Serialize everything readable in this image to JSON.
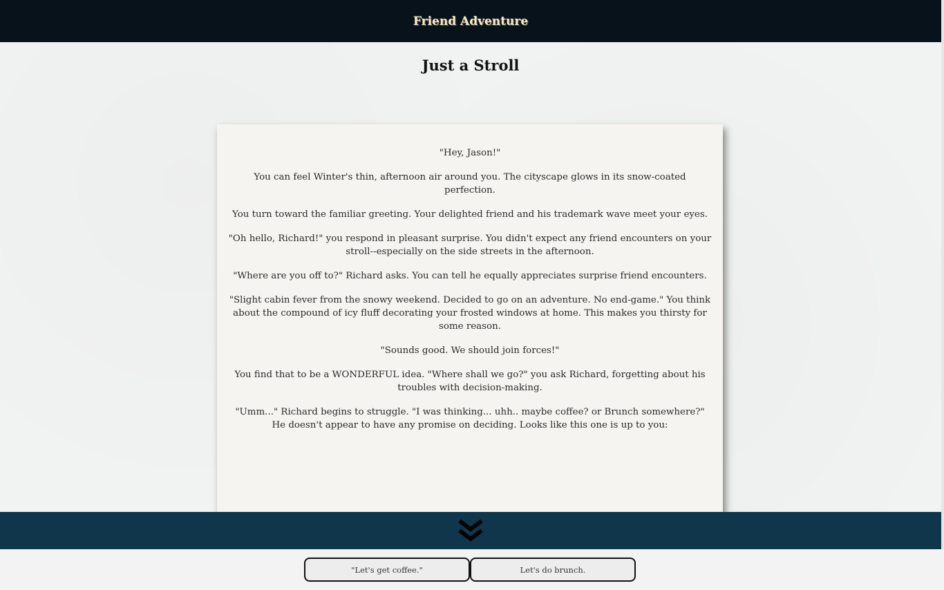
{
  "header": {
    "site_title": "Friend Adventure"
  },
  "chapter": {
    "title": "Just a Stroll"
  },
  "story": {
    "paragraphs": [
      "\"Hey, Jason!\"",
      "You can feel Winter's thin, afternoon air around you. The cityscape glows in its snow-coated perfection.",
      "You turn toward the familiar greeting. Your delighted friend and his trademark wave meet your eyes.",
      "\"Oh hello, Richard!\" you respond in pleasant surprise. You didn't expect any friend encounters on your stroll--especially on the side streets in the afternoon.",
      "\"Where are you off to?\" Richard asks. You can tell he equally appreciates surprise friend encounters.",
      "\"Slight cabin fever from the snowy weekend. Decided to go on an adventure. No end-game.\" You think about the compound of icy fluff decorating your frosted windows at home. This makes you thirsty for some reason.",
      "\"Sounds good. We should join forces!\"",
      "You find that to be a WONDERFUL idea. \"Where shall we go?\" you ask Richard, forgetting about his troubles with decision-making.",
      "\"Umm...\" Richard begins to struggle. \"I was thinking... uhh.. maybe coffee? or Brunch somewhere?\" He doesn't appear to have any promise on deciding. Looks like this one is up to you:"
    ]
  },
  "scroll": {
    "icon": "double-chevron-down-icon"
  },
  "choices": [
    {
      "label": "\"Let's get coffee.\""
    },
    {
      "label": "Let's do brunch."
    }
  ],
  "colors": {
    "header_bg": "#08121a",
    "band_bg": "#0f364b",
    "card_bg": "#f5f4f0"
  }
}
